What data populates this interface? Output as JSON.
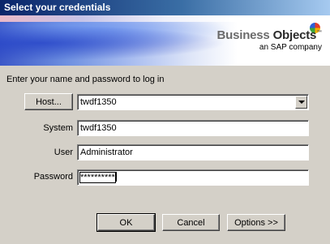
{
  "window": {
    "title": "Select your credentials"
  },
  "banner": {
    "brand_word1": "Business",
    "brand_word2": "Objects",
    "brand_mark": "™",
    "brand_sub": "an SAP company"
  },
  "prompt": "Enter your name and password to log in",
  "host": {
    "button_label": "Host...",
    "value": "twdf1350"
  },
  "system": {
    "label": "System",
    "value": "twdf1350"
  },
  "user": {
    "label": "User",
    "value": "Administrator"
  },
  "password": {
    "label": "Password",
    "masked_value": "**********"
  },
  "buttons": {
    "ok": "OK",
    "cancel": "Cancel",
    "options": "Options >>"
  },
  "colors": {
    "titlebar_start": "#0a246a",
    "titlebar_end": "#a6caf0",
    "dialog_bg": "#d4d0c8"
  }
}
